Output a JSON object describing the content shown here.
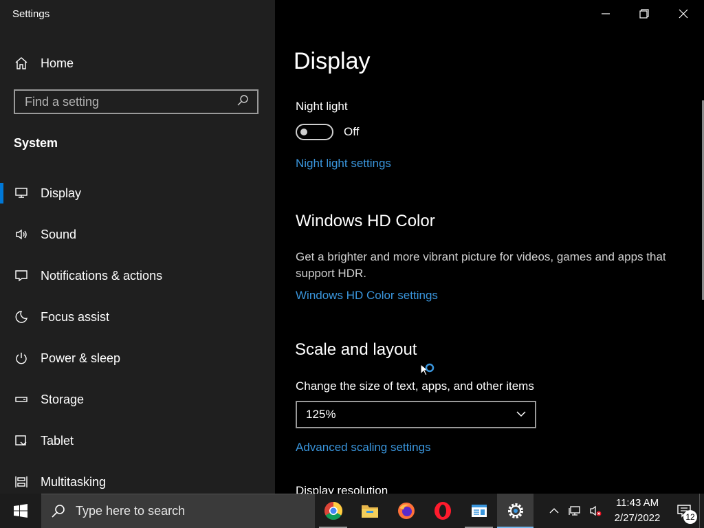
{
  "window": {
    "title": "Settings"
  },
  "sidebar": {
    "home_label": "Home",
    "search_placeholder": "Find a setting",
    "section_title": "System",
    "items": [
      {
        "label": "Display",
        "icon": "monitor-icon",
        "active": true
      },
      {
        "label": "Sound",
        "icon": "speaker-icon"
      },
      {
        "label": "Notifications & actions",
        "icon": "notification-icon"
      },
      {
        "label": "Focus assist",
        "icon": "moon-icon"
      },
      {
        "label": "Power & sleep",
        "icon": "power-icon"
      },
      {
        "label": "Storage",
        "icon": "storage-icon"
      },
      {
        "label": "Tablet",
        "icon": "tablet-icon"
      },
      {
        "label": "Multitasking",
        "icon": "multitasking-icon"
      }
    ]
  },
  "main": {
    "title": "Display",
    "night_light": {
      "label": "Night light",
      "toggle_state": "Off",
      "settings_link": "Night light settings"
    },
    "hd_color": {
      "heading": "Windows HD Color",
      "description": "Get a brighter and more vibrant picture for videos, games and apps that support HDR.",
      "settings_link": "Windows HD Color settings"
    },
    "scale_layout": {
      "heading": "Scale and layout",
      "size_label": "Change the size of text, apps, and other items",
      "size_value": "125%",
      "advanced_link": "Advanced scaling settings",
      "next_label": "Display resolution"
    }
  },
  "taskbar": {
    "search_placeholder": "Type here to search",
    "apps": [
      "chrome-icon",
      "file-explorer-icon",
      "firefox-icon",
      "opera-icon",
      "notepad-icon",
      "settings-icon"
    ],
    "clock_time": "11:43 AM",
    "clock_date": "2/27/2022",
    "notification_count": "12"
  },
  "colors": {
    "accent": "#0078d7",
    "link": "#3a96dd",
    "sidebar_bg": "#1f1f1f",
    "main_bg": "#000000"
  }
}
